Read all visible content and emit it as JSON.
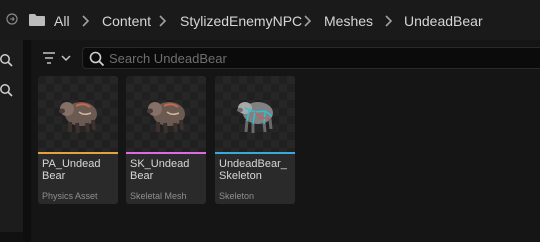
{
  "breadcrumb": {
    "items": [
      "All",
      "Content",
      "StylizedEnemyNPC",
      "Meshes",
      "UndeadBear"
    ]
  },
  "search": {
    "placeholder": "Search UndeadBear"
  },
  "assets": [
    {
      "name": "PA_Undead\nBear",
      "type": "Physics Asset",
      "color": "#e6a23c"
    },
    {
      "name": "SK_Undead\nBear",
      "type": "Skeletal Mesh",
      "color": "#e06ae0"
    },
    {
      "name": "UndeadBear_\nSkeleton",
      "type": "Skeleton",
      "color": "#3aa9d9"
    }
  ],
  "icons": {
    "nav": "history-circle-icon",
    "folder": "folder-icon",
    "separator": "chevron-right-icon",
    "filter": "filter-icon",
    "search": "search-icon"
  }
}
